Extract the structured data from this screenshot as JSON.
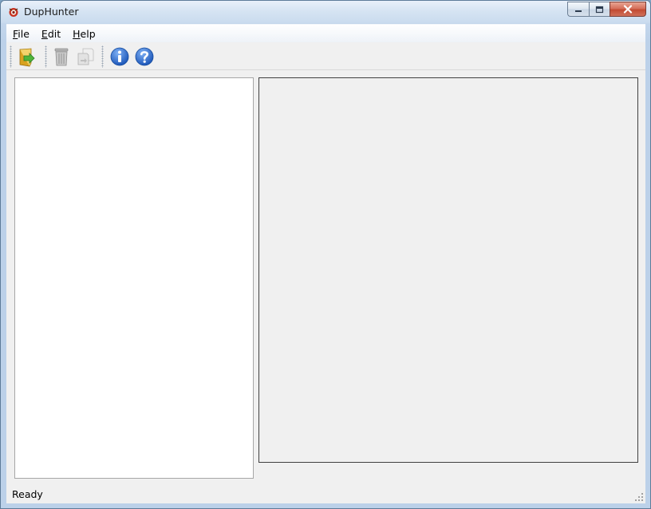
{
  "window": {
    "title": "DupHunter",
    "controls": {
      "minimize_icon": "minimize-icon",
      "maximize_icon": "maximize-icon",
      "close_icon": "close-icon"
    }
  },
  "menu": {
    "items": [
      {
        "accel": "F",
        "rest": "ile"
      },
      {
        "accel": "E",
        "rest": "dit"
      },
      {
        "accel": "H",
        "rest": "elp"
      }
    ]
  },
  "toolbar": {
    "buttons": [
      {
        "icon": "open-folder-icon",
        "enabled": true
      },
      {
        "icon": "trash-icon",
        "enabled": false
      },
      {
        "icon": "move-file-icon",
        "enabled": false
      },
      {
        "icon": "info-icon",
        "enabled": true
      },
      {
        "icon": "help-icon",
        "enabled": true
      }
    ]
  },
  "status": {
    "text": "Ready"
  },
  "colors": {
    "accent_blue": "#2b6bc7",
    "folder_yellow": "#e8b92c",
    "close_red": "#c24a32"
  }
}
